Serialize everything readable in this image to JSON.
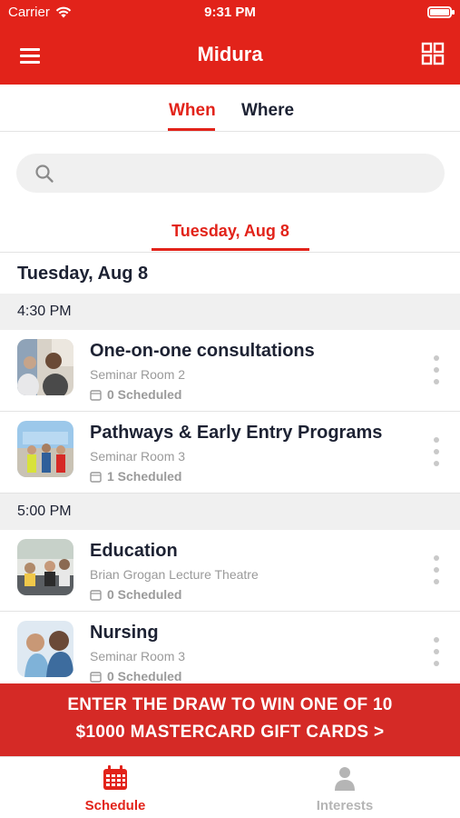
{
  "status_bar": {
    "carrier": "Carrier",
    "time": "9:31 PM"
  },
  "header": {
    "title": "Midura",
    "menu_icon": "hamburger-menu-icon",
    "grid_icon": "grid-view-icon",
    "color": "#e2231a"
  },
  "tabs": {
    "when": "When",
    "where": "Where",
    "active": "When"
  },
  "search": {
    "placeholder": "",
    "value": ""
  },
  "date_selector": {
    "selected": "Tuesday, Aug 8"
  },
  "schedule": {
    "day_heading": "Tuesday, Aug 8",
    "groups": [
      {
        "time": "4:30 PM",
        "sessions": [
          {
            "title": "One-on-one consultations",
            "room": "Seminar Room 2",
            "scheduled": "0 Scheduled"
          },
          {
            "title": "Pathways & Early Entry Programs",
            "room": "Seminar Room 3",
            "scheduled": "1 Scheduled"
          }
        ]
      },
      {
        "time": "5:00 PM",
        "sessions": [
          {
            "title": "Education",
            "room": "Brian Grogan Lecture Theatre",
            "scheduled": "0 Scheduled"
          },
          {
            "title": "Nursing",
            "room": "Seminar Room 3",
            "scheduled": "0 Scheduled"
          }
        ]
      }
    ]
  },
  "banner": {
    "line1": "ENTER THE DRAW TO WIN ONE OF 10",
    "line2": "$1000 MASTERCARD GIFT CARDS >",
    "color": "#d52a26"
  },
  "tab_bar": {
    "schedule": "Schedule",
    "interests": "Interests",
    "active": "Schedule",
    "active_color": "#e2231a",
    "inactive_color": "#b5b5b5"
  }
}
